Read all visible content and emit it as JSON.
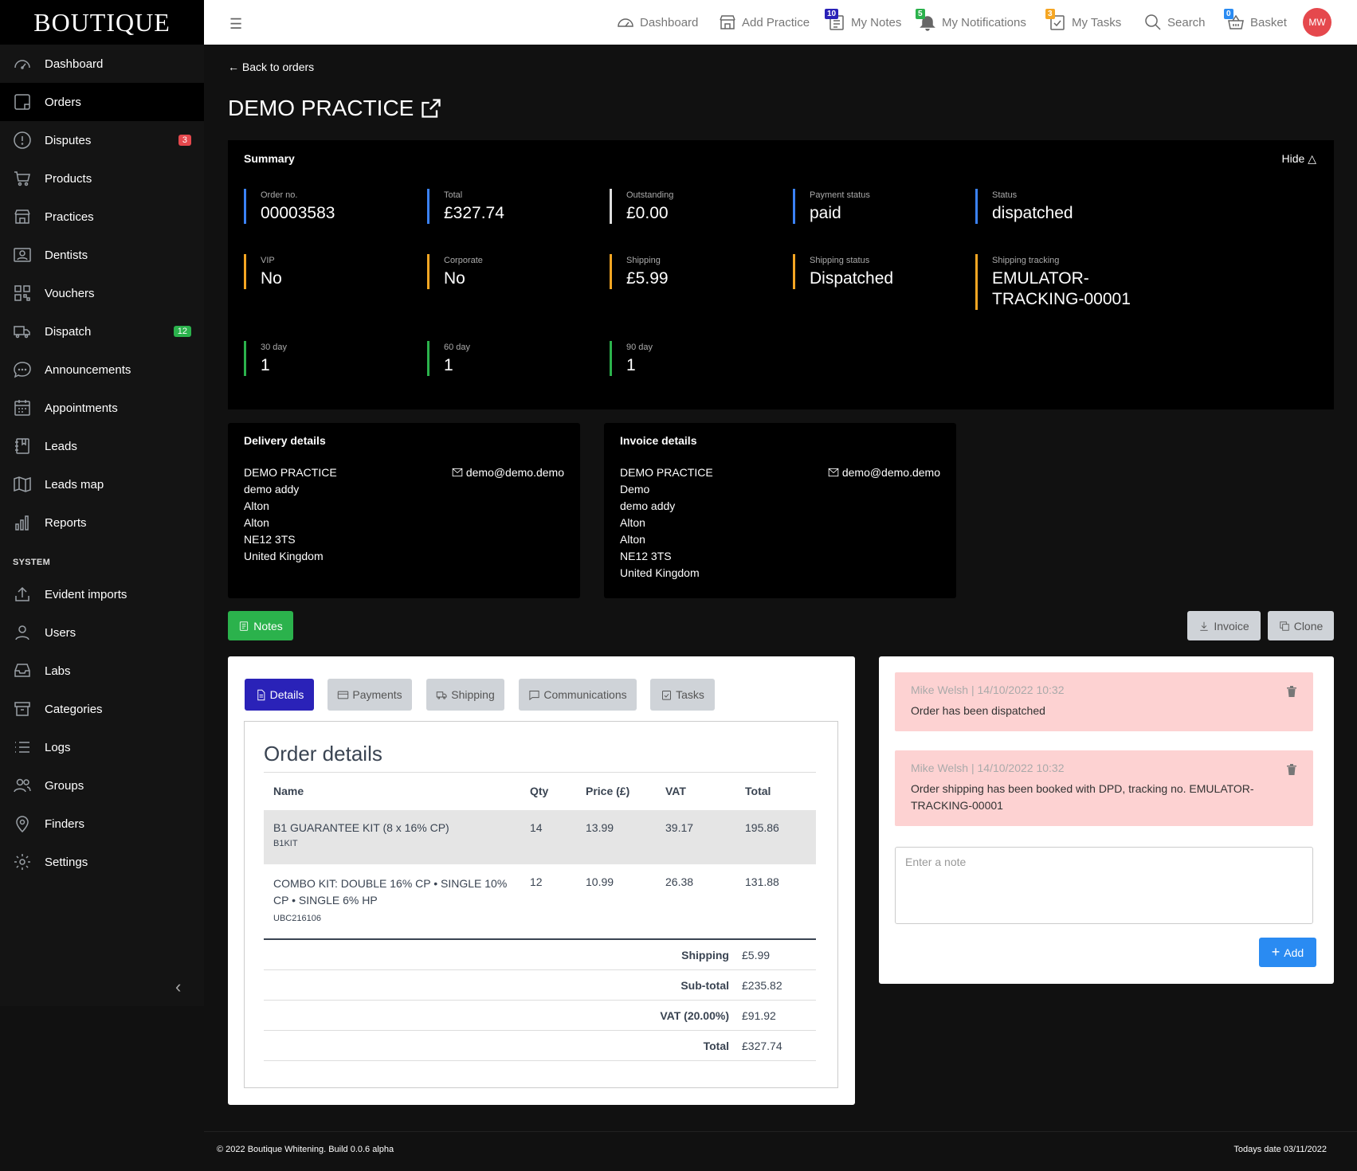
{
  "brand": "BOUTIQUE",
  "sidebar": {
    "items": [
      {
        "label": "Dashboard",
        "icon": "dashboard-icon"
      },
      {
        "label": "Orders",
        "icon": "orders-icon",
        "active": true
      },
      {
        "label": "Disputes",
        "icon": "alert-icon",
        "badge": "3"
      },
      {
        "label": "Products",
        "icon": "cart-icon"
      },
      {
        "label": "Practices",
        "icon": "store-icon"
      },
      {
        "label": "Dentists",
        "icon": "person-card-icon"
      },
      {
        "label": "Vouchers",
        "icon": "qr-code-icon"
      },
      {
        "label": "Dispatch",
        "icon": "truck-icon",
        "badge": "12"
      },
      {
        "label": "Announcements",
        "icon": "chat-icon"
      },
      {
        "label": "Appointments",
        "icon": "calendar-icon"
      },
      {
        "label": "Leads",
        "icon": "notebook-icon"
      },
      {
        "label": "Leads map",
        "icon": "map-icon"
      },
      {
        "label": "Reports",
        "icon": "bar-chart-icon"
      }
    ],
    "section_label": "SYSTEM",
    "system_items": [
      {
        "label": "Evident imports",
        "icon": "upload-icon"
      },
      {
        "label": "Users",
        "icon": "user-icon"
      },
      {
        "label": "Labs",
        "icon": "inbox-icon"
      },
      {
        "label": "Categories",
        "icon": "archive-icon"
      },
      {
        "label": "Logs",
        "icon": "list-icon"
      },
      {
        "label": "Groups",
        "icon": "people-icon"
      },
      {
        "label": "Finders",
        "icon": "pin-icon"
      },
      {
        "label": "Settings",
        "icon": "gear-icon"
      }
    ]
  },
  "topbar": {
    "dashboard": "Dashboard",
    "add_practice": "Add Practice",
    "my_notes": "My Notes",
    "my_notes_badge": "10",
    "my_notifications": "My Notifications",
    "my_notifications_badge": "5",
    "my_tasks": "My Tasks",
    "my_tasks_badge": "3",
    "search": "Search",
    "basket": "Basket",
    "basket_badge": "0",
    "avatar": "MW"
  },
  "back_link": "Back to orders",
  "page_title": "DEMO PRACTICE",
  "summary": {
    "title": "Summary",
    "hide_label": "Hide",
    "order_no_label": "Order no.",
    "order_no": "00003583",
    "total_label": "Total",
    "total": "£327.74",
    "outstanding_label": "Outstanding",
    "outstanding": "£0.00",
    "payment_status_label": "Payment status",
    "payment_status": "paid",
    "status_label": "Status",
    "status": "dispatched",
    "vip_label": "VIP",
    "vip": "No",
    "corporate_label": "Corporate",
    "corporate": "No",
    "shipping_label": "Shipping",
    "shipping": "£5.99",
    "shipping_status_label": "Shipping status",
    "shipping_status": "Dispatched",
    "tracking_label": "Shipping tracking",
    "tracking": "EMULATOR-TRACKING-00001",
    "d30_label": "30 day",
    "d30": "1",
    "d60_label": "60 day",
    "d60": "1",
    "d90_label": "90 day",
    "d90": "1"
  },
  "delivery": {
    "title": "Delivery details",
    "email": "demo@demo.demo",
    "lines": [
      "DEMO PRACTICE",
      "demo addy",
      "Alton",
      "Alton",
      "NE12 3TS",
      "United Kingdom"
    ]
  },
  "invoice_details": {
    "title": "Invoice details",
    "email": "demo@demo.demo",
    "lines": [
      "DEMO PRACTICE",
      "Demo",
      "demo addy",
      "Alton",
      "Alton",
      "NE12 3TS",
      "United Kingdom"
    ]
  },
  "buttons": {
    "notes": "Notes",
    "invoice": "Invoice",
    "clone": "Clone",
    "add": "Add"
  },
  "tabs": [
    "Details",
    "Payments",
    "Shipping",
    "Communications",
    "Tasks"
  ],
  "order_details": {
    "title": "Order details",
    "columns": [
      "Name",
      "Qty",
      "Price (£)",
      "VAT",
      "Total"
    ],
    "rows": [
      {
        "name": "B1 GUARANTEE KIT (8 x 16% CP)",
        "code": "B1KIT",
        "qty": "14",
        "price": "13.99",
        "vat": "39.17",
        "total": "195.86"
      },
      {
        "name": "COMBO KIT: DOUBLE 16% CP • SINGLE 10% CP • SINGLE 6% HP",
        "code": "UBC216106",
        "qty": "12",
        "price": "10.99",
        "vat": "26.38",
        "total": "131.88"
      }
    ],
    "totals": [
      {
        "label": "Shipping",
        "value": "£5.99"
      },
      {
        "label": "Sub-total",
        "value": "£235.82"
      },
      {
        "label": "VAT (20.00%)",
        "value": "£91.92"
      },
      {
        "label": "Total",
        "value": "£327.74"
      }
    ]
  },
  "notes": [
    {
      "meta": "Mike Welsh | 14/10/2022 10:32",
      "body": "Order has been dispatched"
    },
    {
      "meta": "Mike Welsh | 14/10/2022 10:32",
      "body": "Order shipping has been booked with DPD, tracking no. EMULATOR-TRACKING-00001"
    }
  ],
  "note_input_placeholder": "Enter a note",
  "footer": {
    "left": "© 2022 Boutique Whitening. Build 0.0.6 alpha",
    "right": "Todays date 03/11/2022"
  },
  "colors": {
    "blue": "#3b82f6",
    "yellow": "#f5a623",
    "green": "#2bb24c",
    "red": "#e5484d",
    "tab_active": "#2a22b8"
  }
}
